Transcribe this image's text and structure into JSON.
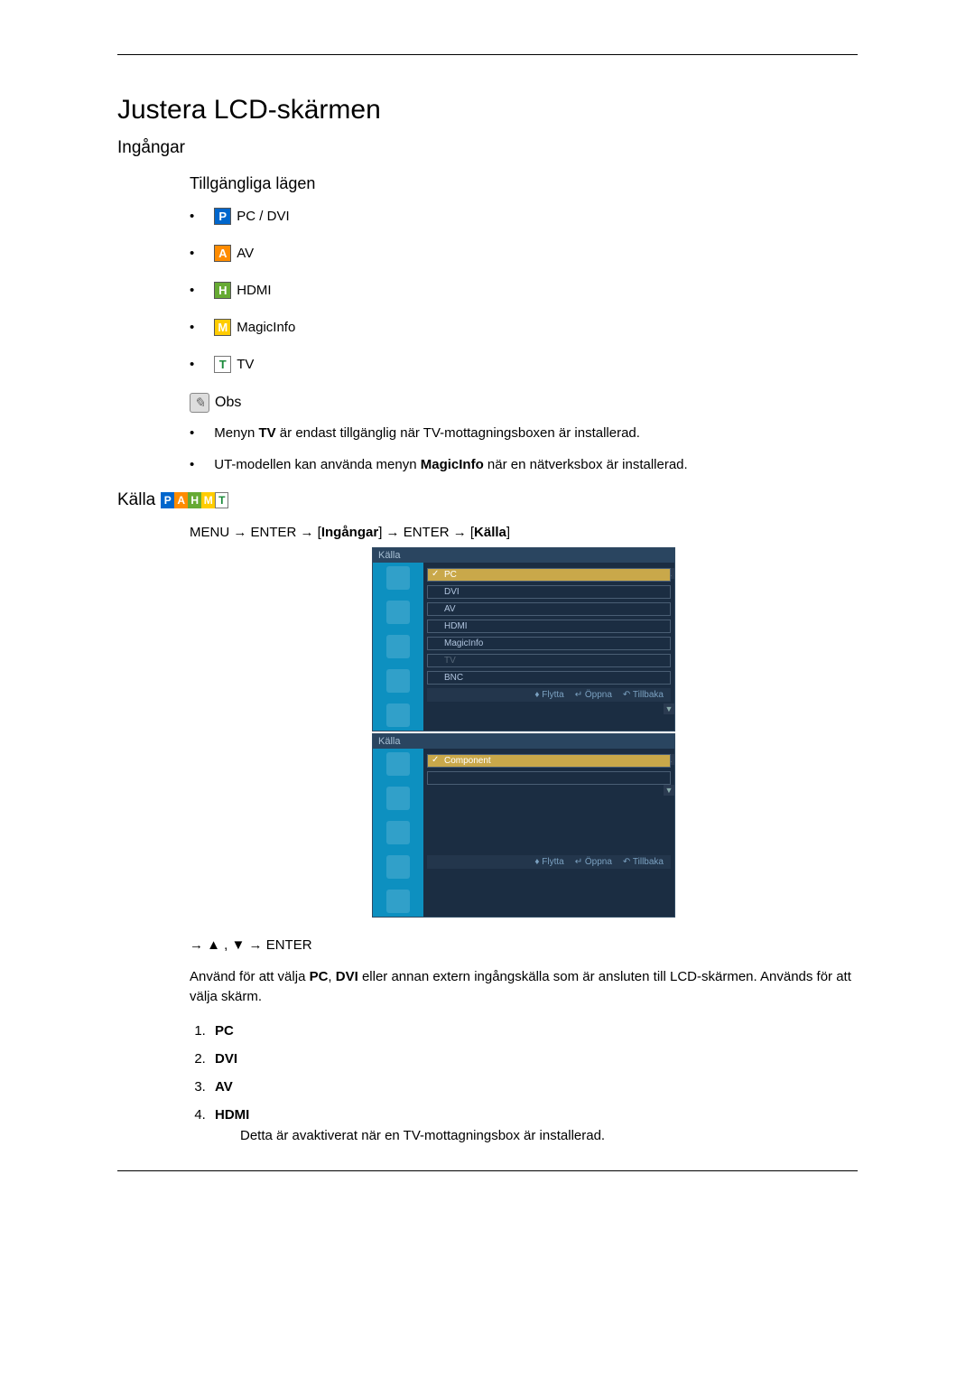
{
  "title": "Justera LCD-skärmen",
  "section_inputs": "Ingångar",
  "available_modes_heading": "Tillgängliga lägen",
  "modes": {
    "p": {
      "letter": "P",
      "label": " PC / DVI"
    },
    "a": {
      "letter": "A",
      "label": " AV"
    },
    "h": {
      "letter": "H",
      "label": " HDMI"
    },
    "m": {
      "letter": "M",
      "label": " MagicInfo"
    },
    "t": {
      "letter": "T",
      "label": " TV"
    }
  },
  "note_label": "Obs",
  "notes": {
    "n1_a": "Menyn ",
    "n1_b": "TV",
    "n1_c": " är endast tillgänglig när TV-mottagningsboxen är installerad.",
    "n2_a": "UT-modellen kan använda menyn ",
    "n2_b": "MagicInfo",
    "n2_c": " när en nätverksbox är installerad."
  },
  "source_heading": "Källa",
  "strip": {
    "p": "P",
    "a": "A",
    "h": "H",
    "m": "M",
    "t": "T"
  },
  "menu_path_a": "MENU → ENTER → [",
  "menu_path_b": "Ingångar",
  "menu_path_c": "] → ENTER → [",
  "menu_path_d": "Källa",
  "menu_path_e": "]",
  "osd": {
    "title": "Källa",
    "items1": {
      "i1": "PC",
      "i2": "DVI",
      "i3": "AV",
      "i4": "HDMI",
      "i5": "MagicInfo",
      "i6": "TV",
      "i7": "BNC"
    },
    "items2": {
      "i1": "Component"
    },
    "foot_move": "Flytta",
    "foot_open": "Öppna",
    "foot_back": "Tillbaka"
  },
  "nav_line": "→ ▲ , ▼ → ENTER",
  "desc_a": "Använd för att välja ",
  "desc_b": "PC",
  "desc_c": ", ",
  "desc_d": "DVI",
  "desc_e": " eller annan extern ingångskälla som är ansluten till LCD-skärmen. Används för att välja skärm.",
  "src_list": {
    "s1": "PC",
    "s2": "DVI",
    "s3": "AV",
    "s4": "HDMI"
  },
  "hdmi_note": "Detta är avaktiverat när en TV-mottagningsbox är installerad."
}
